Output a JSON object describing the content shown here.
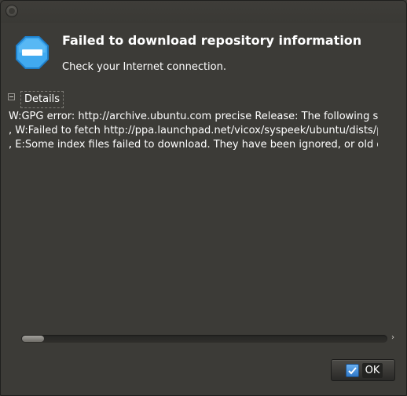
{
  "dialog": {
    "title": "Failed to download repository information",
    "message": "Check your Internet connection."
  },
  "details": {
    "label": "Details",
    "lines": [
      "W:GPG error: http://archive.ubuntu.com precise Release: The following signatures",
      ", W:Failed to fetch http://ppa.launchpad.net/vicox/syspeek/ubuntu/dists/precise",
      ", E:Some index files failed to download. They have been ignored, or old ones used instead."
    ]
  },
  "buttons": {
    "ok_label": "OK"
  },
  "icons": {
    "dialog_icon": "error-stop-icon",
    "button_icon": "checkmark-icon"
  },
  "colors": {
    "background": "#3c3b37",
    "error_icon": "#3aa3e8",
    "text": "#ffffff"
  }
}
